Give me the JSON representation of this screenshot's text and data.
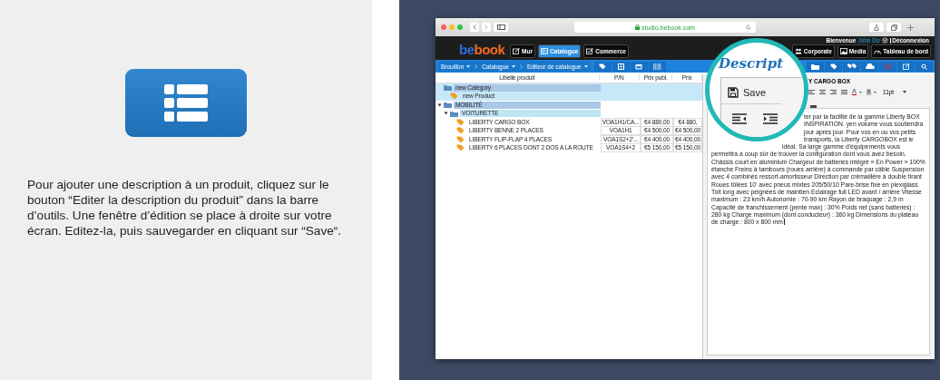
{
  "instruction_panel": {
    "text": "Pour ajouter une description à un produit, cliquez sur le bouton “Editer la description du produit” dans la barre d’outils. Une fenêtre d’édition se place à droite sur votre écran. Editez-la, puis sauvegarder en cliquant sur “Save“."
  },
  "browser": {
    "url": "studio.bebook.com"
  },
  "app": {
    "logo_start": "be",
    "logo_end": "book",
    "welcome": "Bienvenue",
    "user": "John Do",
    "logout": "Déconnexion",
    "nav": [
      {
        "label": "Mur",
        "selected": false
      },
      {
        "label": "Catalogue",
        "selected": true
      },
      {
        "label": "Commerce",
        "selected": false
      },
      {
        "label": "Corporate",
        "selected": false
      },
      {
        "label": "Media",
        "selected": false
      },
      {
        "label": "Tableau de bord",
        "selected": false
      }
    ]
  },
  "breadcrumb": [
    {
      "label": "Brouillon"
    },
    {
      "label": "Catalogue"
    },
    {
      "label": "Editeur de catalogue"
    }
  ],
  "table": {
    "columns": [
      "Libellé produit",
      "P/N",
      "Prix publ.",
      "Prix"
    ],
    "rows": [
      {
        "kind": "category",
        "label": "new Category",
        "selected": true,
        "children": [
          {
            "kind": "product",
            "label": "new Product",
            "selected": true
          }
        ]
      },
      {
        "kind": "category",
        "label": "MOBILITÉ",
        "selected": false,
        "expanded": true,
        "children": [
          {
            "kind": "category",
            "label": "VOITURETTE",
            "selected": false,
            "expanded": true,
            "children": [
              {
                "kind": "product",
                "label": "LIBERTY CARGO BOX",
                "selected": false,
                "cells": [
                  "VOA1H1/CA...",
                  "€4 880,00",
                  "€4 880,"
                ]
              },
              {
                "kind": "product",
                "label": "LIBERTY BENNE 2 PLACES",
                "selected": false,
                "cells": [
                  "VOA1H1",
                  "€4 500,00",
                  "€4 500,00"
                ]
              },
              {
                "kind": "product",
                "label": "LIBERTY FLIP-FLAP 4 PLACES",
                "selected": false,
                "cells": [
                  "VOA1S2+2'...",
                  "€4 400,00",
                  "€4 400,00"
                ]
              },
              {
                "kind": "product",
                "label": "LIBERTY 6 PLACES DONT 2 DOS A LA ROUTE",
                "selected": false,
                "cells": [
                  "VOA1S4+2",
                  "€5 150,00",
                  "€5 150,00"
                ]
              }
            ]
          }
        ]
      }
    ]
  },
  "editor": {
    "title": "Y CARGO BOX",
    "font_size": "11pt",
    "body": "ter par la facilité de la gamme Liberty BOX INSPIRATION. yen volume vous soutiendra jour après jour. Pour vos en ou vos petits transports, la Liberty CARGOBOX est le idéal. Sa large gamme d'équipements vous permettra à coup sûr de trouver la configuration dont vous avez besoin. Châssis court en aluminium Chargeur de batteries intégré « En Power » 100% étanche Freins à tambours (roues arrière) à commande par câble Suspension avec 4 combinés ressort-amortisseur Direction par crémaillère à double tirant Roues tôlées 10' avec pneus mixtes 205/50/10 Pare-brise fixe en plexiglass Toit long avec peignées de maintien Eclairage full LED avant / arrière Vitesse maximum : 23 km/h Autonomie : 70-90 km Rayon de braquage : 2,9 m Capacité de franchissement (pente max) : 30% Poids net (sans batteries) : 280 kg Charge maximum (dont conducteur) : 360 kg Dimensions du plateau de charge : 800 x 800 mm"
  },
  "magnifier": {
    "title": "Descript",
    "save": "Save"
  }
}
